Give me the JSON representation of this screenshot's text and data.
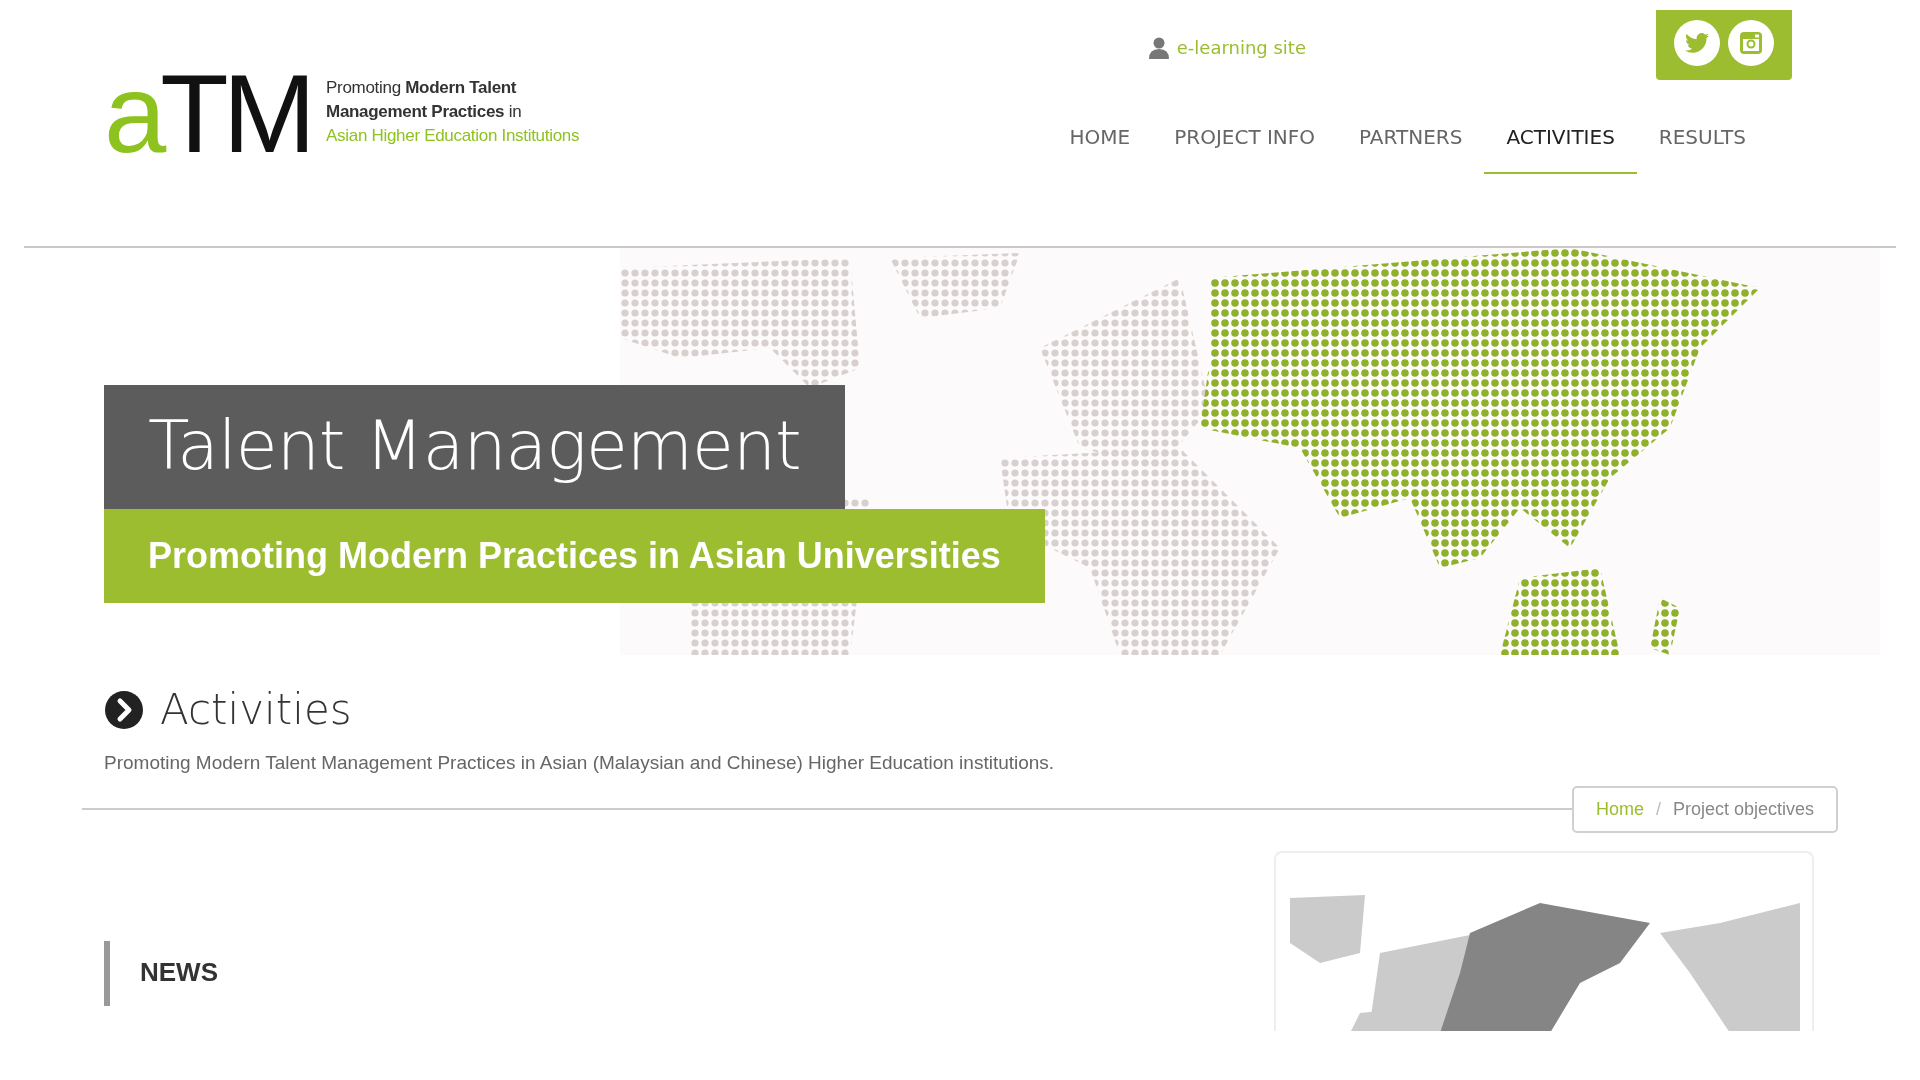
{
  "logo": {
    "mark": "aTM",
    "tagline": [
      "Promoting **Modern Talent**",
      "**Management Practices** in",
      "Asian Higher Education Institutions"
    ]
  },
  "top_link": {
    "label": "e-learning site"
  },
  "social": [
    {
      "kind": "twitter"
    },
    {
      "kind": "instagram"
    }
  ],
  "nav": [
    {
      "label": "HOME",
      "selected": false
    },
    {
      "label": "PROJECT INFO",
      "selected": false
    },
    {
      "label": "PARTNERS",
      "selected": false
    },
    {
      "label": "ACTIVITIES",
      "selected": true
    },
    {
      "label": "RESULTS",
      "selected": false
    }
  ],
  "hero": {
    "title": "Talent Management",
    "subtitle": "Promoting Modern Practices in Asian Universities"
  },
  "page": {
    "heading": "Activities",
    "description": "Promoting Modern Talent Management Practices in Asian (Malaysian and Chinese) Higher Education institutions."
  },
  "breadcrumb": [
    {
      "label": "Home",
      "kind": "link"
    },
    {
      "label": "/",
      "kind": "separator"
    },
    {
      "label": "Project objectives",
      "kind": "current"
    }
  ],
  "news": {
    "heading": "NEWS"
  }
}
